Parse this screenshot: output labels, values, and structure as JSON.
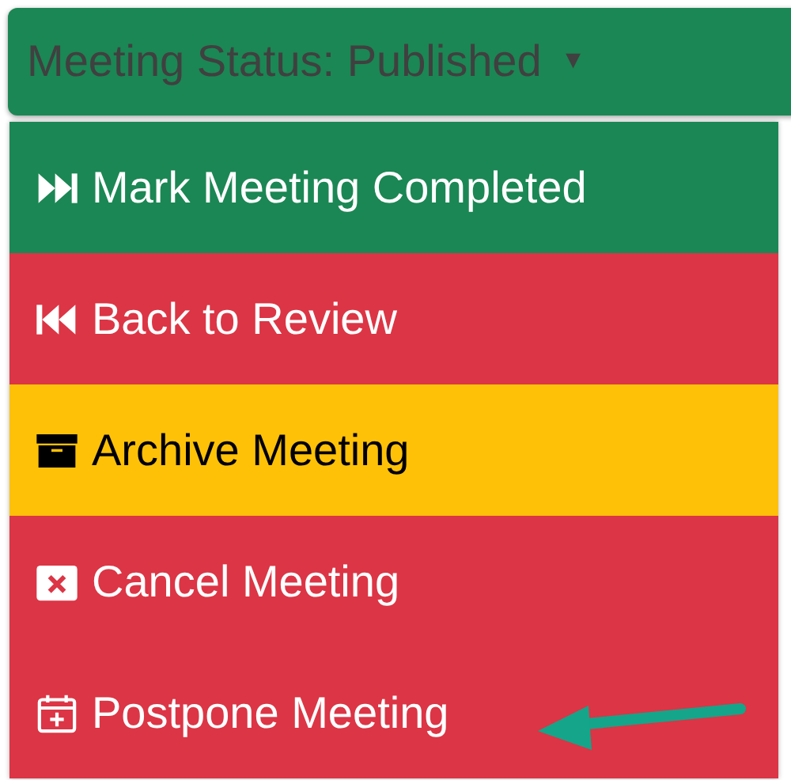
{
  "status_button": {
    "label": "Meeting Status: Published",
    "caret": "▼",
    "expanded": true
  },
  "menu_items": [
    {
      "label": "Mark Meeting Completed",
      "kind": "complete",
      "color": "#1b8754"
    },
    {
      "label": "Back to Review",
      "kind": "back",
      "color": "#dc3545"
    },
    {
      "label": "Archive Meeting",
      "kind": "archive",
      "color": "#ffc107"
    },
    {
      "label": "Cancel Meeting",
      "kind": "cancel",
      "color": "#dc3545"
    },
    {
      "label": "Postpone Meeting",
      "kind": "postpone",
      "color": "#dc3545"
    }
  ]
}
